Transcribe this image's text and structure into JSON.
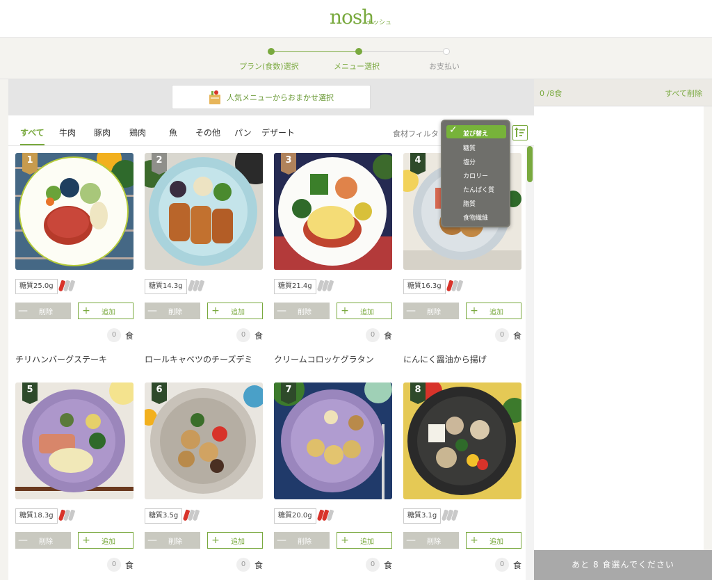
{
  "brand": {
    "logo": "nosh",
    "logo_kana": "ナッシュ"
  },
  "steps": [
    {
      "label": "プラン(食数)選択",
      "state": "done"
    },
    {
      "label": "メニュー選択",
      "state": "current"
    },
    {
      "label": "お支払い",
      "state": "pending"
    }
  ],
  "promo": {
    "label": "人気メニューからおまかせ選択"
  },
  "tabs": [
    "すべて",
    "牛肉",
    "豚肉",
    "鶏肉",
    "魚",
    "その他",
    "パン",
    "デザート"
  ],
  "filter": {
    "label": "食材フィルタ ▾"
  },
  "sort_menu": {
    "selected": "並び替え",
    "options": [
      "糖質",
      "塩分",
      "カロリー",
      "たんぱく質",
      "脂質",
      "食物繊維"
    ]
  },
  "buttons": {
    "delete": "削除",
    "add": "追加"
  },
  "qty_unit": "食",
  "menu": [
    {
      "rank": "1",
      "sugar": "糖質25.0g",
      "spice": 1,
      "qty": "0",
      "name": "チリハンバーグステーキ"
    },
    {
      "rank": "2",
      "sugar": "糖質14.3g",
      "spice": 0,
      "qty": "0",
      "name": "ロールキャベツのチーズデミ"
    },
    {
      "rank": "3",
      "sugar": "糖質21.4g",
      "spice": 0,
      "qty": "0",
      "name": "クリームコロッケグラタン"
    },
    {
      "rank": "4",
      "sugar": "糖質16.3g",
      "spice": 1,
      "qty": "0",
      "name": "にんにく醤油から揚げ"
    },
    {
      "rank": "5",
      "sugar": "糖質18.3g",
      "spice": 1,
      "qty": "0",
      "name": ""
    },
    {
      "rank": "6",
      "sugar": "糖質3.5g",
      "spice": 1,
      "qty": "0",
      "name": ""
    },
    {
      "rank": "7",
      "sugar": "糖質20.0g",
      "spice": 2,
      "qty": "0",
      "name": ""
    },
    {
      "rank": "8",
      "sugar": "糖質3.1g",
      "spice": 0,
      "qty": "0",
      "name": ""
    }
  ],
  "cart": {
    "count": "0 /8食",
    "clear": "すべて削除",
    "footer": "あと 8 食選んでください"
  },
  "colors": {
    "accent": "#79a93e",
    "pepper_red": "#d8332a",
    "pepper_gray": "#c9c9c9"
  }
}
